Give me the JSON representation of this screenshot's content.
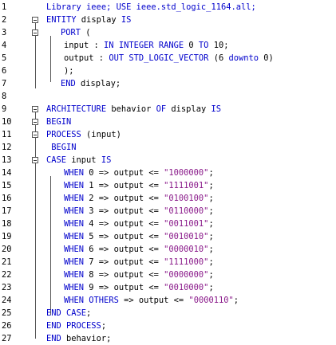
{
  "lines": [
    {
      "n": "1",
      "fold": false,
      "indent": 0,
      "parts": [
        {
          "t": "Library ieee; USE ieee.std_logic_1164.all;",
          "c": "kw"
        }
      ]
    },
    {
      "n": "2",
      "fold": true,
      "indent": 0,
      "parts": [
        {
          "t": "ENTITY",
          "c": "kw"
        },
        {
          "t": " display ",
          "c": "nm"
        },
        {
          "t": "IS",
          "c": "kw"
        }
      ]
    },
    {
      "n": "3",
      "fold": true,
      "indent": 1,
      "parts": [
        {
          "t": "PORT",
          "c": "kw"
        },
        {
          "t": " (",
          "c": "nm"
        }
      ]
    },
    {
      "n": "4",
      "fold": false,
      "indent": 2,
      "parts": [
        {
          "t": "input : ",
          "c": "nm"
        },
        {
          "t": "IN INTEGER RANGE",
          "c": "kw"
        },
        {
          "t": " 0 ",
          "c": "nm"
        },
        {
          "t": "TO",
          "c": "kw"
        },
        {
          "t": " 10;",
          "c": "nm"
        }
      ]
    },
    {
      "n": "5",
      "fold": false,
      "indent": 2,
      "parts": [
        {
          "t": "output : ",
          "c": "nm"
        },
        {
          "t": "OUT STD_LOGIC_VECTOR",
          "c": "kw"
        },
        {
          "t": " (6 ",
          "c": "nm"
        },
        {
          "t": "downto",
          "c": "kw"
        },
        {
          "t": " 0)",
          "c": "nm"
        }
      ]
    },
    {
      "n": "6",
      "fold": false,
      "indent": 2,
      "parts": [
        {
          "t": ");",
          "c": "nm"
        }
      ]
    },
    {
      "n": "7",
      "fold": false,
      "indent": 1,
      "parts": [
        {
          "t": "END",
          "c": "kw"
        },
        {
          "t": " display;",
          "c": "nm"
        }
      ]
    },
    {
      "n": "8",
      "fold": false,
      "indent": 0,
      "parts": []
    },
    {
      "n": "9",
      "fold": true,
      "indent": 0,
      "parts": [
        {
          "t": "ARCHITECTURE",
          "c": "kw"
        },
        {
          "t": " behavior ",
          "c": "nm"
        },
        {
          "t": "OF",
          "c": "kw"
        },
        {
          "t": " display ",
          "c": "nm"
        },
        {
          "t": "IS",
          "c": "kw"
        }
      ]
    },
    {
      "n": "10",
      "fold": true,
      "indent": 0,
      "parts": [
        {
          "t": "BEGIN",
          "c": "kw"
        }
      ]
    },
    {
      "n": "11",
      "fold": true,
      "indent": 0,
      "parts": [
        {
          "t": "PROCESS",
          "c": "kw"
        },
        {
          "t": " (input)",
          "c": "nm"
        }
      ]
    },
    {
      "n": "12",
      "fold": false,
      "indent": 0,
      "parts": [
        {
          "t": " BEGIN",
          "c": "kw"
        }
      ]
    },
    {
      "n": "13",
      "fold": true,
      "indent": 0,
      "parts": [
        {
          "t": "CASE",
          "c": "kw"
        },
        {
          "t": " input ",
          "c": "nm"
        },
        {
          "t": "IS",
          "c": "kw"
        }
      ]
    },
    {
      "n": "14",
      "fold": false,
      "indent": 3,
      "parts": [
        {
          "t": "WHEN",
          "c": "kw"
        },
        {
          "t": " 0 => output <= ",
          "c": "nm"
        },
        {
          "t": "\"1000000\"",
          "c": "st"
        },
        {
          "t": ";",
          "c": "nm"
        }
      ]
    },
    {
      "n": "15",
      "fold": false,
      "indent": 3,
      "parts": [
        {
          "t": "WHEN",
          "c": "kw"
        },
        {
          "t": " 1 => output <= ",
          "c": "nm"
        },
        {
          "t": "\"1111001\"",
          "c": "st"
        },
        {
          "t": ";",
          "c": "nm"
        }
      ]
    },
    {
      "n": "16",
      "fold": false,
      "indent": 3,
      "parts": [
        {
          "t": "WHEN",
          "c": "kw"
        },
        {
          "t": " 2 => output <= ",
          "c": "nm"
        },
        {
          "t": "\"0100100\"",
          "c": "st"
        },
        {
          "t": ";",
          "c": "nm"
        }
      ]
    },
    {
      "n": "17",
      "fold": false,
      "indent": 3,
      "parts": [
        {
          "t": "WHEN",
          "c": "kw"
        },
        {
          "t": " 3 => output <= ",
          "c": "nm"
        },
        {
          "t": "\"0110000\"",
          "c": "st"
        },
        {
          "t": ";",
          "c": "nm"
        }
      ]
    },
    {
      "n": "18",
      "fold": false,
      "indent": 3,
      "parts": [
        {
          "t": "WHEN",
          "c": "kw"
        },
        {
          "t": " 4 => output <= ",
          "c": "nm"
        },
        {
          "t": "\"0011001\"",
          "c": "st"
        },
        {
          "t": ";",
          "c": "nm"
        }
      ]
    },
    {
      "n": "19",
      "fold": false,
      "indent": 3,
      "parts": [
        {
          "t": "WHEN",
          "c": "kw"
        },
        {
          "t": " 5 => output <= ",
          "c": "nm"
        },
        {
          "t": "\"0010010\"",
          "c": "st"
        },
        {
          "t": ";",
          "c": "nm"
        }
      ]
    },
    {
      "n": "20",
      "fold": false,
      "indent": 3,
      "parts": [
        {
          "t": "WHEN",
          "c": "kw"
        },
        {
          "t": " 6 => output <= ",
          "c": "nm"
        },
        {
          "t": "\"0000010\"",
          "c": "st"
        },
        {
          "t": ";",
          "c": "nm"
        }
      ]
    },
    {
      "n": "21",
      "fold": false,
      "indent": 3,
      "parts": [
        {
          "t": "WHEN",
          "c": "kw"
        },
        {
          "t": " 7 => output <= ",
          "c": "nm"
        },
        {
          "t": "\"1111000\"",
          "c": "st"
        },
        {
          "t": ";",
          "c": "nm"
        }
      ]
    },
    {
      "n": "22",
      "fold": false,
      "indent": 3,
      "parts": [
        {
          "t": "WHEN",
          "c": "kw"
        },
        {
          "t": " 8 => output <= ",
          "c": "nm"
        },
        {
          "t": "\"0000000\"",
          "c": "st"
        },
        {
          "t": ";",
          "c": "nm"
        }
      ]
    },
    {
      "n": "23",
      "fold": false,
      "indent": 3,
      "parts": [
        {
          "t": "WHEN",
          "c": "kw"
        },
        {
          "t": " 9 => output <= ",
          "c": "nm"
        },
        {
          "t": "\"0010000\"",
          "c": "st"
        },
        {
          "t": ";",
          "c": "nm"
        }
      ]
    },
    {
      "n": "24",
      "fold": false,
      "indent": 3,
      "parts": [
        {
          "t": "WHEN",
          "c": "kw"
        },
        {
          "t": " ",
          "c": "nm"
        },
        {
          "t": "OTHERS",
          "c": "kw"
        },
        {
          "t": " => output <= ",
          "c": "nm"
        },
        {
          "t": "\"0000110\"",
          "c": "st"
        },
        {
          "t": ";",
          "c": "nm"
        }
      ]
    },
    {
      "n": "25",
      "fold": false,
      "indent": 0,
      "parts": [
        {
          "t": "END CASE",
          "c": "kw"
        },
        {
          "t": ";",
          "c": "nm"
        }
      ]
    },
    {
      "n": "26",
      "fold": false,
      "indent": 0,
      "parts": [
        {
          "t": "END PROCESS",
          "c": "kw"
        },
        {
          "t": ";",
          "c": "nm"
        }
      ]
    },
    {
      "n": "27",
      "fold": false,
      "indent": 0,
      "parts": [
        {
          "t": "END",
          "c": "kw"
        },
        {
          "t": " behavior;",
          "c": "nm"
        }
      ]
    }
  ]
}
